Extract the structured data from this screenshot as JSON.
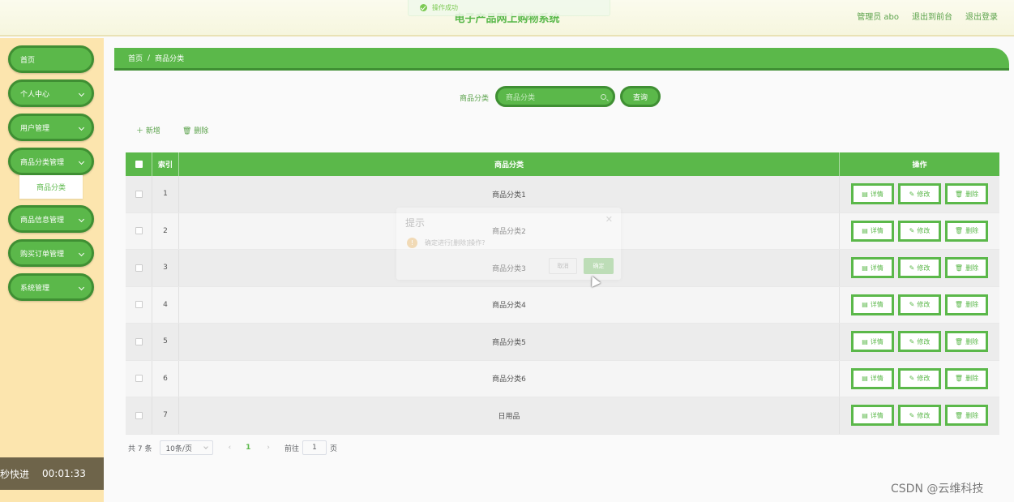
{
  "header": {
    "title": "电子产品网上购物系统",
    "user": "管理员 abo",
    "front_link": "退出到前台",
    "logout": "退出登录"
  },
  "toast": {
    "message": "操作成功"
  },
  "sidebar": {
    "items": [
      {
        "label": "首页",
        "has_arrow": false
      },
      {
        "label": "个人中心",
        "has_arrow": true
      },
      {
        "label": "用户管理",
        "has_arrow": true
      },
      {
        "label": "商品分类管理",
        "has_arrow": true
      },
      {
        "label": "商品信息管理",
        "has_arrow": true
      },
      {
        "label": "购买订单管理",
        "has_arrow": true
      },
      {
        "label": "系统管理",
        "has_arrow": true
      }
    ],
    "active_sub": "商品分类"
  },
  "recorder": {
    "label": "秒快进",
    "time": "00:01:33"
  },
  "breadcrumb": {
    "home": "首页",
    "separator": "/",
    "current": "商品分类"
  },
  "search": {
    "label": "商品分类",
    "placeholder": "商品分类",
    "button": "查询"
  },
  "toolbar": {
    "add": "新增",
    "delete": "删除"
  },
  "table": {
    "headers": {
      "index": "索引",
      "name": "商品分类",
      "ops": "操作"
    },
    "rows": [
      {
        "index": "1",
        "name": "商品分类1"
      },
      {
        "index": "2",
        "name": "商品分类2"
      },
      {
        "index": "3",
        "name": "商品分类3"
      },
      {
        "index": "4",
        "name": "商品分类4"
      },
      {
        "index": "5",
        "name": "商品分类5"
      },
      {
        "index": "6",
        "name": "商品分类6"
      },
      {
        "index": "7",
        "name": "日用品"
      }
    ],
    "op_labels": {
      "detail": "详情",
      "edit": "修改",
      "delete": "删除"
    }
  },
  "pagination": {
    "total": "共 7 条",
    "page_size": "10条/页",
    "current_page": "1",
    "goto_label": "前往",
    "goto_value": "1",
    "goto_unit": "页"
  },
  "dialog": {
    "title": "提示",
    "message": "确定进行[删除]操作?",
    "cancel": "取消",
    "confirm": "确定"
  },
  "watermark": "CSDN @云维科技",
  "colors": {
    "accent": "#5bb84a",
    "accent_dark": "#3f8f33",
    "sidebar_bg": "#fce5ae"
  }
}
